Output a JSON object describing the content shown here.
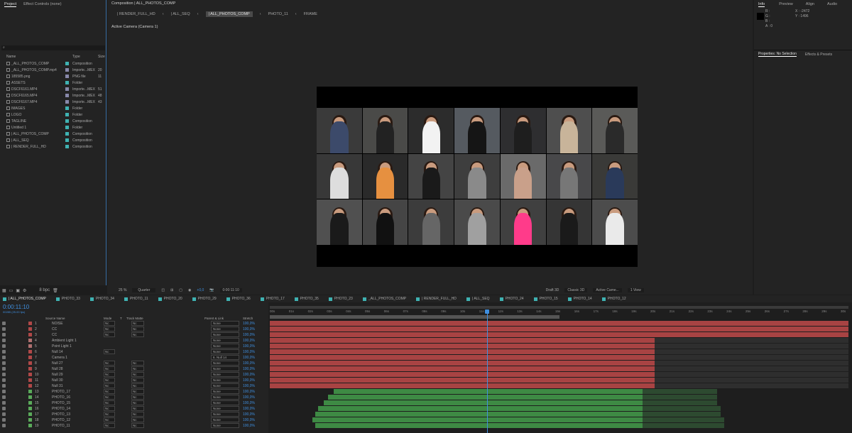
{
  "project": {
    "tab_project": "Project",
    "tab_effects": "Effect Controls (none)",
    "col_name": "Name",
    "col_type": "Type",
    "col_size": "Size",
    "items": [
      {
        "name": "_ALL_PHOTOS_COMP",
        "type": "Composition",
        "size": "",
        "color": "#3fb2b2"
      },
      {
        "name": "_ALL_PHOTOS_COMP.mp4",
        "type": "Importe...MEX",
        "size": "20",
        "color": "#8888aa"
      },
      {
        "name": "185585.png",
        "type": "PNG file",
        "size": "11",
        "color": "#8888aa"
      },
      {
        "name": "ASSETS",
        "type": "Folder",
        "size": "",
        "color": "#3fb2b2"
      },
      {
        "name": "DSCF6161.MP4",
        "type": "Importe...MEX",
        "size": "51",
        "color": "#8888aa"
      },
      {
        "name": "DSCF6165.MP4",
        "type": "Importe...MEX",
        "size": "48",
        "color": "#8888aa"
      },
      {
        "name": "DSCF6167.MP4",
        "type": "Importe...MEX",
        "size": "43",
        "color": "#8888aa"
      },
      {
        "name": "IMAGES",
        "type": "Folder",
        "size": "",
        "color": "#3fb2b2"
      },
      {
        "name": "LOGO",
        "type": "Folder",
        "size": "",
        "color": "#3fb2b2"
      },
      {
        "name": "TAGLINE",
        "type": "Composition",
        "size": "",
        "color": "#3fb2b2"
      },
      {
        "name": "Untitled 1",
        "type": "Folder",
        "size": "",
        "color": "#3fb2b2"
      },
      {
        "name": "| ALL_PHOTOS_COMP",
        "type": "Composition",
        "size": "",
        "color": "#3fb2b2"
      },
      {
        "name": "| ALL_SEQ",
        "type": "Composition",
        "size": "",
        "color": "#3fb2b2"
      },
      {
        "name": "| RENDER_FULL_HD",
        "type": "Composition",
        "size": "",
        "color": "#3fb2b2"
      }
    ],
    "bpc": "8 bpc"
  },
  "composition": {
    "header": "Composition | ALL_PHOTOS_COMP",
    "breadcrumbs": [
      "| RENDER_FULL_HD",
      "| ALL_SEQ",
      "| ALL_PHOTOS_COMP",
      "PHOTO_11",
      "FRAME"
    ],
    "camera_label": "Active Camera (Camera 1)",
    "zoom": "25 %",
    "resolution": "Quarter",
    "timecode": "0:00:11:10",
    "exposure": "+0,0",
    "renderer": "Draft 3D",
    "renderer_type": "Classic 3D",
    "camera_select": "Active Came...",
    "view_select": "1 View"
  },
  "info": {
    "tab_info": "Info",
    "tab_preview": "Preview",
    "tab_align": "Align",
    "tab_audio": "Audio",
    "r": "R :",
    "g": "G :",
    "b": "B :",
    "a": "A : 0",
    "x": "X : -2472",
    "y": "Y : 1496",
    "properties_tab": "Properties: No Selection",
    "effects_tab": "Effects & Presets"
  },
  "timeline": {
    "tabs": [
      "| ALL_PHOTOS_COMP",
      "PHOTO_33",
      "PHOTO_34",
      "PHOTO_11",
      "PHOTO_20",
      "PHOTO_29",
      "PHOTO_36",
      "PHOTO_17",
      "PHOTO_35",
      "PHOTO_23",
      "_ALL_PHOTOS_COMP",
      "| RENDER_FULL_HD",
      "| ALL_SEQ",
      "PHOTO_24",
      "PHOTO_15",
      "PHOTO_14",
      "PHOTO_12"
    ],
    "timecode": "0:00:11:10",
    "timecode_sub": "00285 (25.00 fps)",
    "col_source": "Source Name",
    "col_mode": "Mode",
    "col_t": "T",
    "col_trackmatte": "Track Matte",
    "col_parent": "Parent & Link",
    "col_stretch": "Stretch",
    "ruler": [
      "00s",
      "01s",
      "02s",
      "03s",
      "04s",
      "05s",
      "06s",
      "07s",
      "08s",
      "09s",
      "10s",
      "11s",
      "12s",
      "13s",
      "14s",
      "15s",
      "16s",
      "17s",
      "18s",
      "19s",
      "20s",
      "21s",
      "22s",
      "23s",
      "24s",
      "25s",
      "26s",
      "27s",
      "28s",
      "29s",
      "30s"
    ],
    "layers": [
      {
        "num": "1",
        "name": "NOISE",
        "mode": "Nc",
        "tm": "Nc",
        "parent": "None",
        "stretch": "100,0%",
        "color": "#b04848"
      },
      {
        "num": "2",
        "name": "CC",
        "mode": "Nc",
        "tm": "Nc",
        "parent": "None",
        "stretch": "100,0%",
        "color": "#b04848"
      },
      {
        "num": "3",
        "name": "CC",
        "mode": "Nc",
        "tm": "Nc",
        "parent": "None",
        "stretch": "100,0%",
        "color": "#b04848"
      },
      {
        "num": "4",
        "name": "Ambient Light 1",
        "mode": "",
        "tm": "",
        "parent": "None",
        "stretch": "100,0%",
        "color": "#b07070"
      },
      {
        "num": "5",
        "name": "Point Light 1",
        "mode": "",
        "tm": "",
        "parent": "None",
        "stretch": "100,0%",
        "color": "#b07070"
      },
      {
        "num": "6",
        "name": "Null 14",
        "mode": "Nc",
        "tm": "",
        "parent": "None",
        "stretch": "100,0%",
        "color": "#b04848"
      },
      {
        "num": "7",
        "name": "Camera 1",
        "mode": "",
        "tm": "",
        "parent": "6. Null 14",
        "stretch": "100,0%",
        "color": "#b04848"
      },
      {
        "num": "8",
        "name": "Null 27",
        "mode": "Nc",
        "tm": "Nc",
        "parent": "None",
        "stretch": "100,0%",
        "color": "#b04848"
      },
      {
        "num": "9",
        "name": "Null 28",
        "mode": "Nc",
        "tm": "Nc",
        "parent": "None",
        "stretch": "100,0%",
        "color": "#b04848"
      },
      {
        "num": "10",
        "name": "Null 29",
        "mode": "Nc",
        "tm": "Nc",
        "parent": "None",
        "stretch": "100,0%",
        "color": "#b04848"
      },
      {
        "num": "11",
        "name": "Null 30",
        "mode": "Nc",
        "tm": "Nc",
        "parent": "None",
        "stretch": "100,0%",
        "color": "#b04848"
      },
      {
        "num": "12",
        "name": "Null 31",
        "mode": "Nc",
        "tm": "Nc",
        "parent": "None",
        "stretch": "100,0%",
        "color": "#b04848"
      },
      {
        "num": "13",
        "name": "PHOTO_17",
        "mode": "Nc",
        "tm": "Nc",
        "parent": "None",
        "stretch": "100,0%",
        "color": "#5aaa5a"
      },
      {
        "num": "14",
        "name": "PHOTO_16",
        "mode": "Nc",
        "tm": "Nc",
        "parent": "None",
        "stretch": "100,0%",
        "color": "#5aaa5a"
      },
      {
        "num": "15",
        "name": "PHOTO_15",
        "mode": "Nc",
        "tm": "Nc",
        "parent": "None",
        "stretch": "100,0%",
        "color": "#5aaa5a"
      },
      {
        "num": "16",
        "name": "PHOTO_14",
        "mode": "Nc",
        "tm": "Nc",
        "parent": "None",
        "stretch": "100,0%",
        "color": "#5aaa5a"
      },
      {
        "num": "17",
        "name": "PHOTO_13",
        "mode": "Nc",
        "tm": "Nc",
        "parent": "None",
        "stretch": "100,0%",
        "color": "#5aaa5a"
      },
      {
        "num": "18",
        "name": "PHOTO_12",
        "mode": "Nc",
        "tm": "Nc",
        "parent": "None",
        "stretch": "100,0%",
        "color": "#5aaa5a"
      },
      {
        "num": "19",
        "name": "PHOTO_11",
        "mode": "Nc",
        "tm": "Nc",
        "parent": "None",
        "stretch": "100,0%",
        "color": "#5aaa5a"
      }
    ]
  },
  "colors": {
    "accent": "#3f8fe0",
    "red_layer": "#a84343",
    "green_layer": "#3e8a44",
    "teal_label": "#3fb2b2"
  }
}
